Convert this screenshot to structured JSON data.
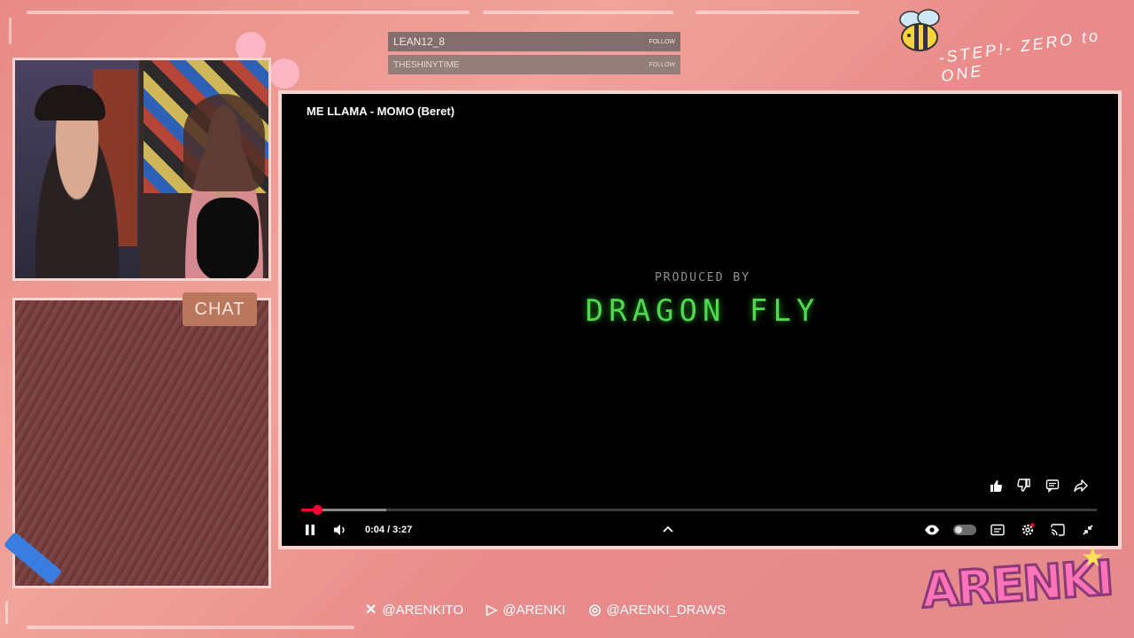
{
  "follows": [
    {
      "name": "LEAN12_8",
      "tag": "FOLLOW"
    },
    {
      "name": "THESHINYTIME",
      "tag": "FOLLOW"
    }
  ],
  "branding": {
    "motto": "-STEP!- ZERO to ONE",
    "logo": "ARENKI"
  },
  "chat": {
    "label": "CHAT"
  },
  "video": {
    "title": "ME LLAMA - MOMO (Beret)",
    "overlay_sub": "PRODUCED BY",
    "overlay_main": "DRAGON FLY",
    "time": "0:04 / 3:27",
    "progress_fraction": 0.02,
    "buffer_fraction": 0.107
  },
  "player_icons": {
    "like": "thumbs-up-icon",
    "dislike": "thumbs-down-icon",
    "comment": "comment-icon",
    "share": "share-icon",
    "pause": "pause-icon",
    "volume": "volume-icon",
    "chevron": "chevron-up-icon",
    "eye": "eye-icon",
    "captions": "captions-icon",
    "settings": "settings-icon",
    "cast": "cast-icon",
    "exit": "exit-fullscreen-icon"
  },
  "socials": [
    {
      "icon": "x-icon",
      "handle": "@ARENKITO"
    },
    {
      "icon": "youtube-icon",
      "handle": "@ARENKI"
    },
    {
      "icon": "instagram-icon",
      "handle": "@ARENKI_DRAWS"
    }
  ],
  "colors": {
    "accent": "#ff0033",
    "frame": "#f7d6d2",
    "background": "#e98a86"
  }
}
